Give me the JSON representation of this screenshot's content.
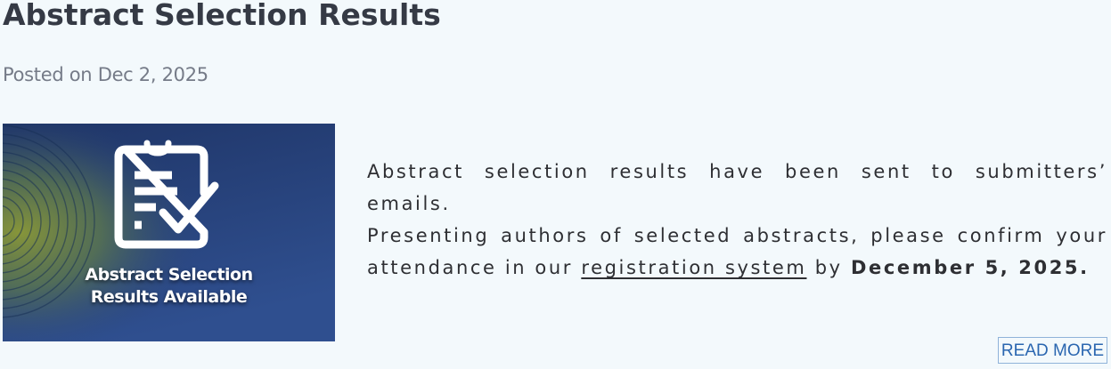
{
  "post": {
    "title": "Abstract Selection Results",
    "date": "Posted on Dec 2, 2025",
    "thumbnail": {
      "caption_line1": "Abstract Selection",
      "caption_line2": "Results Available",
      "icon": "clipboard-check-icon",
      "colors": {
        "background_top": "#1e3566",
        "background_bottom": "#2d4b8a",
        "arc_glow": "#7a8f3c"
      }
    },
    "excerpt": {
      "sentence1": "Abstract selection results have been sent to submitters’ emails.",
      "sentence2_before_link": "Presenting authors of selected abstracts, please confirm your attendance in our ",
      "link_text": "registration system",
      "sentence2_after_link": " by ",
      "deadline": "December 5, 2025."
    },
    "read_more_label": "READ MORE"
  },
  "colors": {
    "page_background": "#f3f9fc",
    "title": "#353a45",
    "date": "#757b88",
    "body_text": "#2e2f33",
    "link_button": "#2a66b0"
  }
}
